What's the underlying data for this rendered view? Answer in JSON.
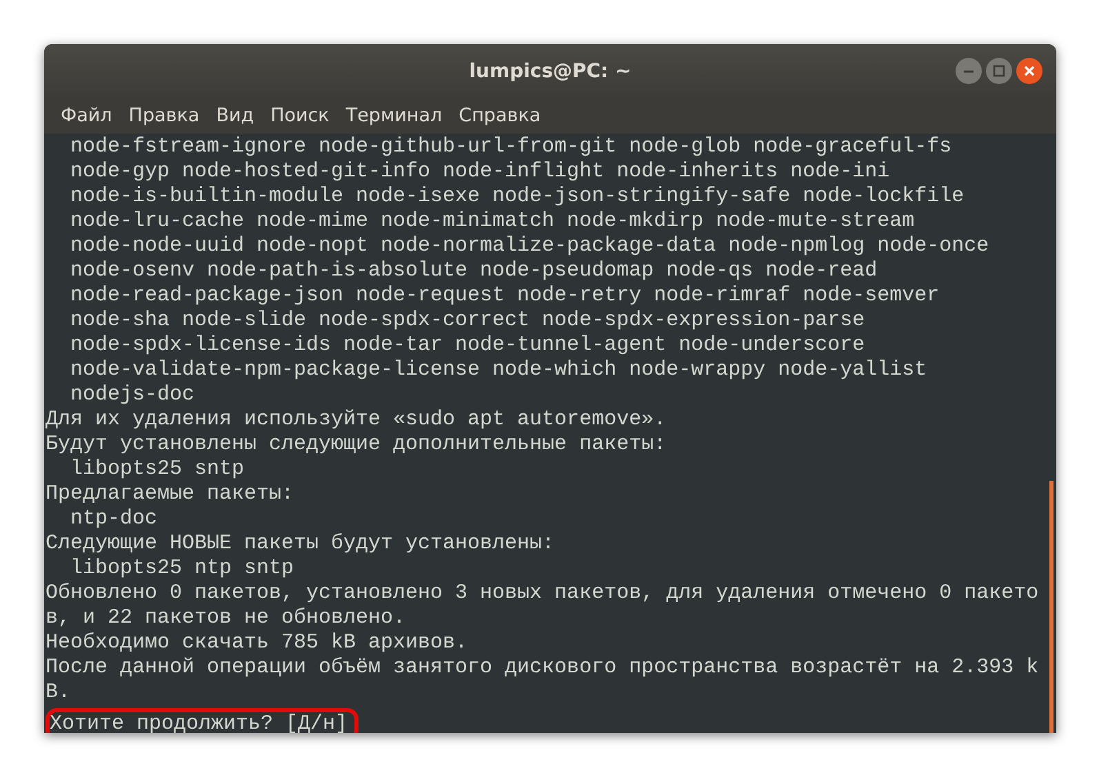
{
  "window": {
    "title": "lumpics@PC: ~",
    "controls": [
      {
        "kind": "minimize"
      },
      {
        "kind": "maximize"
      },
      {
        "kind": "close"
      }
    ]
  },
  "menu": [
    "Файл",
    "Правка",
    "Вид",
    "Поиск",
    "Терминал",
    "Справка"
  ],
  "terminal": {
    "lines": [
      {
        "text": "  node-fstream-ignore node-github-url-from-git node-glob node-graceful-fs",
        "highlighted": false
      },
      {
        "text": "  node-gyp node-hosted-git-info node-inflight node-inherits node-ini",
        "highlighted": false
      },
      {
        "text": "  node-is-builtin-module node-isexe node-json-stringify-safe node-lockfile",
        "highlighted": false
      },
      {
        "text": "  node-lru-cache node-mime node-minimatch node-mkdirp node-mute-stream",
        "highlighted": false
      },
      {
        "text": "  node-node-uuid node-nopt node-normalize-package-data node-npmlog node-once",
        "highlighted": false
      },
      {
        "text": "  node-osenv node-path-is-absolute node-pseudomap node-qs node-read",
        "highlighted": false
      },
      {
        "text": "  node-read-package-json node-request node-retry node-rimraf node-semver",
        "highlighted": false
      },
      {
        "text": "  node-sha node-slide node-spdx-correct node-spdx-expression-parse",
        "highlighted": false
      },
      {
        "text": "  node-spdx-license-ids node-tar node-tunnel-agent node-underscore",
        "highlighted": false
      },
      {
        "text": "  node-validate-npm-package-license node-which node-wrappy node-yallist",
        "highlighted": false
      },
      {
        "text": "  nodejs-doc",
        "highlighted": false
      },
      {
        "text": "Для их удаления используйте «sudo apt autoremove».",
        "highlighted": false
      },
      {
        "text": "Будут установлены следующие дополнительные пакеты:",
        "highlighted": false
      },
      {
        "text": "  libopts25 sntp",
        "highlighted": false
      },
      {
        "text": "Предлагаемые пакеты:",
        "highlighted": false
      },
      {
        "text": "  ntp-doc",
        "highlighted": false
      },
      {
        "text": "Следующие НОВЫЕ пакеты будут установлены:",
        "highlighted": false
      },
      {
        "text": "  libopts25 ntp sntp",
        "highlighted": false
      },
      {
        "text": "Обновлено 0 пакетов, установлено 3 новых пакетов, для удаления отмечено 0 пакето",
        "highlighted": false
      },
      {
        "text": "в, и 22 пакетов не обновлено.",
        "highlighted": false
      },
      {
        "text": "Необходимо скачать 785 kB архивов.",
        "highlighted": false
      },
      {
        "text": "После данной операции объём занятого дискового пространства возрастёт на 2.393 k",
        "highlighted": false
      },
      {
        "text": "B.",
        "highlighted": false
      },
      {
        "text": "Хотите продолжить? [Д/н]",
        "highlighted": true
      }
    ]
  }
}
